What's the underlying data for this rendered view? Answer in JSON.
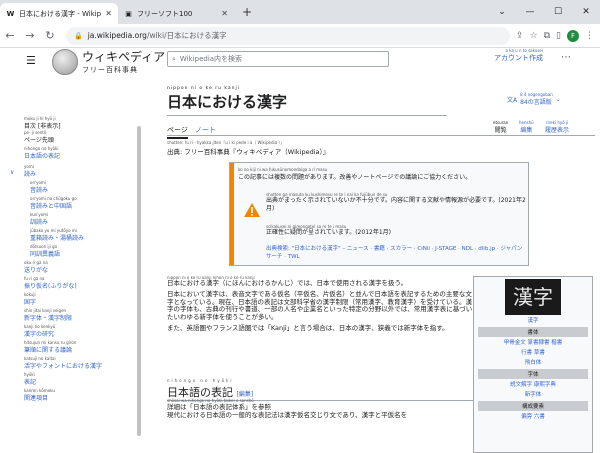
{
  "browser": {
    "tabs": [
      {
        "favicon": "W",
        "title": "日本における漢字 - Wikipedia",
        "active": true
      },
      {
        "favicon": "▣",
        "title": "フリーソフト100",
        "active": false
      }
    ],
    "new_tab": "+",
    "url_domain": "ja.wikipedia.org",
    "url_path": "/wiki/日本における漢字",
    "avatar_letter": "F"
  },
  "site": {
    "logo_title": "ウィキペディア",
    "logo_subtitle": "フリー百科事典",
    "search_placeholder": "Wikipedia内を検索",
    "account_ruby": "a ka u n to sakusei",
    "account_label": "アカウント作成"
  },
  "sidebar": {
    "items": [
      {
        "ruby": "moku ji   hi hyō ji",
        "label": "目次 [非表示]"
      },
      {
        "ruby": "pe- ji sentō",
        "label": "ページ先頭"
      },
      {
        "ruby": "nihongo no hyōki",
        "label": "日本語の表記"
      },
      {
        "ruby": "yomi",
        "label": "読み"
      },
      {
        "ruby": "on'yomi",
        "label": "音読み"
      },
      {
        "ruby": "on'yomi no chūgoku go",
        "label": "音読みと中国語"
      },
      {
        "ruby": "kun'yomi",
        "label": "訓読み"
      },
      {
        "ruby": "jūbako yo mi   yutōyo mi",
        "label": "重箱読み・湯桶読み"
      },
      {
        "ruby": "dōtsuon   iji go",
        "label": "同訓異義語"
      },
      {
        "ruby": "oku ri ga na",
        "label": "送りがな"
      },
      {
        "ruby": "fu ri ga na",
        "label": "振り仮名(ふりがな)"
      },
      {
        "ruby": "kokuji",
        "label": "国字"
      },
      {
        "ruby": "shin jitai   kanji seigen",
        "label": "新字体・漢字制限"
      },
      {
        "ruby": "kanji no kenkyū",
        "label": "漢字の研究"
      },
      {
        "ruby": "hitsujun mi kansu ru giron",
        "label": "筆順に関する議論"
      },
      {
        "ruby": "katsuji no kaitai",
        "label": "活字やフォントにおける漢字"
      },
      {
        "ruby": "hyōki",
        "label": "表記"
      },
      {
        "ruby": "kanren kōmoku",
        "label": "関連項目"
      }
    ],
    "toggle_glyph": "∨"
  },
  "article": {
    "title_ruby": "nippon   ni   o   ke ru   kanji",
    "title": "日本における漢字",
    "lang_count": "84の言語版",
    "lang_ruby": "8 4 nogengoban",
    "tabs": {
      "page": "ページ",
      "talk": "ノート",
      "read": "閲覧",
      "edit": "編集",
      "history": "履歴表示",
      "read_ruby": "etsuran",
      "edit_ruby": "henshū",
      "history_ruby": "rireki hyō ji"
    },
    "source_ruby": "shutten: fu ri - hyakka jiten「u i ki pede i a（ Wikipedia ）」",
    "source": "出典: フリー百科事典『ウィキペディア（Wikipedia）』",
    "notice": {
      "row1_ruby": "ko no kiji ni wa fukusūnomondaiga a ri masu",
      "row1": "この記事には複数の問題があります。改善やノートページでの議論にご協力ください。",
      "row2_ruby": "shutten ga masuta ku kushimesu re te i nai   ka fujūbun de su",
      "row2": "出典がまったく示されていないか不十分です。内容に関する文献や情報源が必要です。(2021年2月)",
      "row3_ruby": "scikakusei ni gimongatei sa re te i masu",
      "row3": "正確性に疑問が呈されています。(2012年1月)",
      "cats": "出典検索: \"日本における漢字\" – ニュース · 書籍 · スカラー · CiNii · J-STAGE · NDL · dlib.jp · ジャパンサーチ · TWL"
    },
    "para1_ruby": "nippon ni o ke ru kanji   nihon ni o ke ru kanji",
    "para1": "日本における漢字（にほんにおけるかんじ）では、日本で使用される漢字を扱う。",
    "para2": "日本において漢字は、表音文字である仮名（平仮名、片仮名）と並んで日本語を表記するための主要な文字となっている。現在、日本語の表記は文部科学省の漢字制限（常用漢字、教育漢字）を受けている。漢字の字体も、古典の刊行や書道、一部の人名や企業名といった特定の分野以外では、常用漢字表に基づいたいわゆる新字体を使うことが多い。",
    "para3": "また、英語圏やフランス語圏では「Kanji」と言う場合は、日本の漢字、狭義では新字体を指す。",
    "h2_ruby": "nihongo  no  hyōki",
    "h2": "日本語の表記",
    "h2_edit": "[編集]",
    "after_ruby": "shōsai wa nihongo no hyōki taikei o sanshō",
    "after1": "詳細は「日本語の表記体系」を参照",
    "after2": "現代における日本語の一般的な表記法は漢字仮名交じり文であり、漢字と平仮名を"
  },
  "infobox": {
    "kanji": "漢字",
    "kanji_label": "漢字",
    "rows": [
      {
        "head": "書体",
        "values": [
          "甲骨金文 篆書隸書 楷書",
          "行書 草書",
          "飛白体"
        ]
      },
      {
        "head": "字体",
        "values": [
          "説文解字 康煕字典",
          "新字体"
        ]
      },
      {
        "head": "構成要素",
        "values": [
          "偏旁 六書"
        ]
      }
    ]
  }
}
